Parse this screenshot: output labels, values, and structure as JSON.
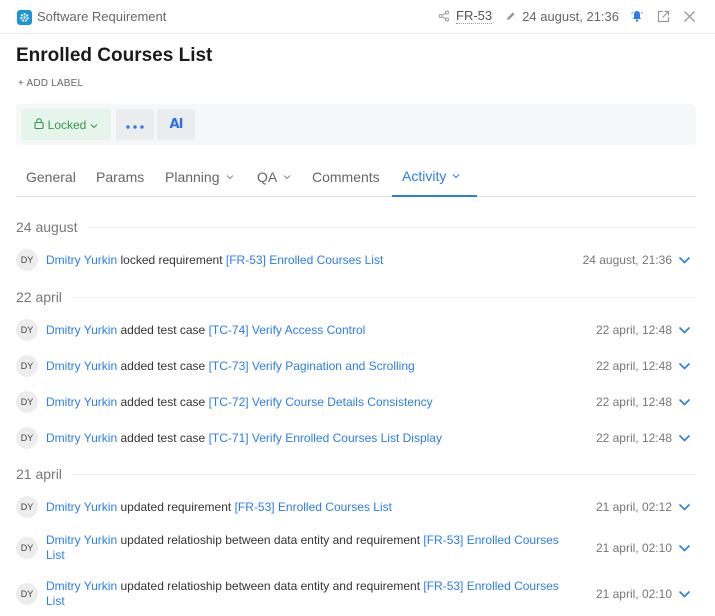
{
  "header": {
    "app_icon": "gear-icon",
    "app_title": "Software Requirement",
    "share_icon": "share-icon",
    "requirement_id": "FR-53",
    "edit_icon": "pencil-icon",
    "modified_date": "24 august, 21:36",
    "bell_icon": "bell-icon",
    "open_external_icon": "external-link-icon",
    "close_icon": "close-icon"
  },
  "page": {
    "title": "Enrolled Courses List",
    "add_label": "+ ADD LABEL"
  },
  "toolbar": {
    "locked_label": "Locked",
    "more_icon": "more-dots-icon",
    "ai_label": "AI"
  },
  "tabs": [
    {
      "label": "General",
      "dropdown": false,
      "active": false
    },
    {
      "label": "Params",
      "dropdown": false,
      "active": false
    },
    {
      "label": "Planning",
      "dropdown": true,
      "active": false
    },
    {
      "label": "QA",
      "dropdown": true,
      "active": false
    },
    {
      "label": "Comments",
      "dropdown": false,
      "active": false
    },
    {
      "label": "Activity",
      "dropdown": true,
      "active": true
    }
  ],
  "activity": {
    "groups": [
      {
        "date": "24 august",
        "items": [
          {
            "initials": "DY",
            "user": "Dmitry Yurkin",
            "action": "locked requirement",
            "link": "[FR-53] Enrolled Courses List",
            "time": "24 august, 21:36"
          }
        ]
      },
      {
        "date": "22 april",
        "items": [
          {
            "initials": "DY",
            "user": "Dmitry Yurkin",
            "action": "added test case",
            "link": "[TC-74] Verify Access Control",
            "time": "22 april, 12:48"
          },
          {
            "initials": "DY",
            "user": "Dmitry Yurkin",
            "action": "added test case",
            "link": "[TC-73] Verify Pagination and Scrolling",
            "time": "22 april, 12:48"
          },
          {
            "initials": "DY",
            "user": "Dmitry Yurkin",
            "action": "added test case",
            "link": "[TC-72] Verify Course Details Consistency",
            "time": "22 april, 12:48"
          },
          {
            "initials": "DY",
            "user": "Dmitry Yurkin",
            "action": "added test case",
            "link": "[TC-71] Verify Enrolled Courses List Display",
            "time": "22 april, 12:48"
          }
        ]
      },
      {
        "date": "21 april",
        "items": [
          {
            "initials": "DY",
            "user": "Dmitry Yurkin",
            "action": "updated requirement",
            "link": "[FR-53] Enrolled Courses List",
            "time": "21 april, 02:12"
          },
          {
            "initials": "DY",
            "user": "Dmitry Yurkin",
            "action": "updated relatioship between data entity and requirement",
            "link": "[FR-53] Enrolled Courses List",
            "time": "21 april, 02:10"
          },
          {
            "initials": "DY",
            "user": "Dmitry Yurkin",
            "action": "updated relatioship between data entity and requirement",
            "link": "[FR-53] Enrolled Courses List",
            "time": "21 april, 02:10"
          }
        ]
      }
    ]
  },
  "colors": {
    "accent": "#2b7de9",
    "locked_green": "#2f9a4a",
    "app_icon_blue": "#1a95d9"
  }
}
